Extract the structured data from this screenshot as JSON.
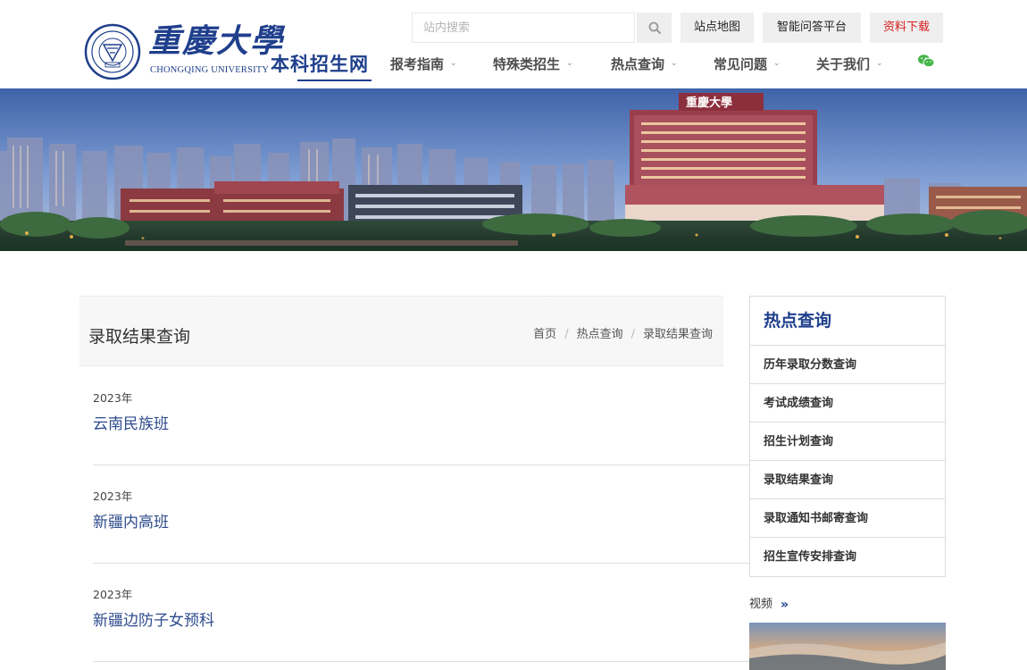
{
  "header": {
    "logo_cn": "重慶大學",
    "logo_en": "CHONGQING UNIVERSITY",
    "site_name": "本科招生网",
    "search_placeholder": "站内搜索",
    "top_links": [
      "站点地图",
      "智能问答平台",
      "资料下载"
    ],
    "nav": [
      "报考指南",
      "特殊类招生",
      "热点查询",
      "常见问题",
      "关于我们"
    ]
  },
  "banner": {
    "sign_text": "重慶大學",
    "sign_sub": "CHONGQING UNIVERSITY"
  },
  "main": {
    "page_title": "录取结果查询",
    "breadcrumb": [
      "首页",
      "热点查询",
      "录取结果查询"
    ],
    "items": [
      {
        "year": "2023年",
        "name": "云南民族班"
      },
      {
        "year": "2023年",
        "name": "新疆内高班"
      },
      {
        "year": "2023年",
        "name": "新疆边防子女预科"
      }
    ]
  },
  "sidebar": {
    "heading": "热点查询",
    "items": [
      "历年录取分数查询",
      "考试成绩查询",
      "招生计划查询",
      "录取结果查询",
      "录取通知书邮寄查询",
      "招生宣传安排查询"
    ],
    "video_label": "视频"
  },
  "colors": {
    "brand_blue": "#1f3f8c",
    "link_blue": "#2d4b8c",
    "download_red": "#d81e1e",
    "wechat_green": "#44b549"
  },
  "icons": [
    "university-seal-icon",
    "search-icon",
    "chevron-down-icon",
    "wechat-icon",
    "double-chevron-right-icon"
  ]
}
